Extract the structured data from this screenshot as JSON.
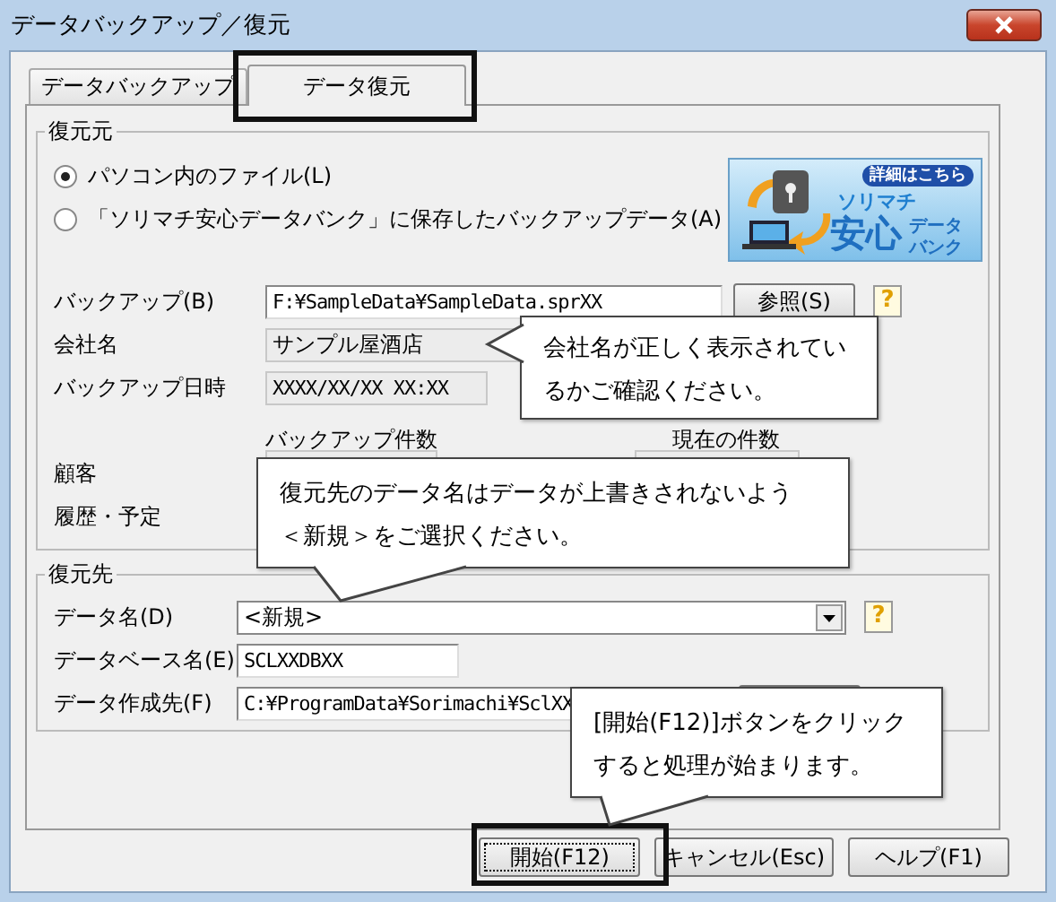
{
  "window": {
    "title": "データバックアップ／復元"
  },
  "tabs": [
    {
      "label": "データバックアップ",
      "selected": false,
      "annotated": false
    },
    {
      "label": "データ復元",
      "selected": true,
      "annotated": true
    }
  ],
  "source": {
    "legend": "復元元",
    "options": [
      {
        "label": "パソコン内のファイル(L)",
        "selected": true
      },
      {
        "label": "「ソリマチ安心データバンク」に保存したバックアップデータ(A)",
        "selected": false
      }
    ],
    "banner": {
      "badge": "詳細はこちら",
      "brand": "ソリマチ",
      "big": "安心",
      "small_top": "データ",
      "small_bottom": "バンク"
    },
    "backup": {
      "label": "バックアップ(B)",
      "value": "F:¥SampleData¥SampleData.sprXX",
      "button": "参照(S)",
      "help": "?"
    },
    "company": {
      "label": "会社名",
      "value": "サンプル屋酒店"
    },
    "datetime": {
      "label": "バックアップ日時",
      "value": "XXXX/XX/XX XX:XX"
    },
    "count_headers": [
      "バックアップ件数",
      "現在の件数"
    ],
    "count_rows": [
      "顧客",
      "履歴・予定"
    ]
  },
  "destination": {
    "legend": "復元先",
    "data_name": {
      "label": "データ名(D)",
      "value": "<新規>",
      "help": "?"
    },
    "db_name": {
      "label": "データベース名(E)",
      "value": "SCLXXDBXX"
    },
    "folder": {
      "label": "データ作成先(F)",
      "value": "C:¥ProgramData¥Sorimachi¥SclXX"
    }
  },
  "buttons": [
    {
      "label": "開始(F12)",
      "annotated": true,
      "focused": true
    },
    {
      "label": "キャンセル(Esc)",
      "annotated": false,
      "focused": false
    },
    {
      "label": "ヘルプ(F1)",
      "annotated": false,
      "focused": false
    }
  ],
  "callouts": [
    {
      "text": "会社名が正しく表示されているかご確認ください。"
    },
    {
      "text": "復元先のデータ名はデータが上書きされないよう＜新規＞をご選択ください。"
    },
    {
      "text": "[開始(F12)]ボタンをクリックすると処理が始まります。"
    }
  ]
}
